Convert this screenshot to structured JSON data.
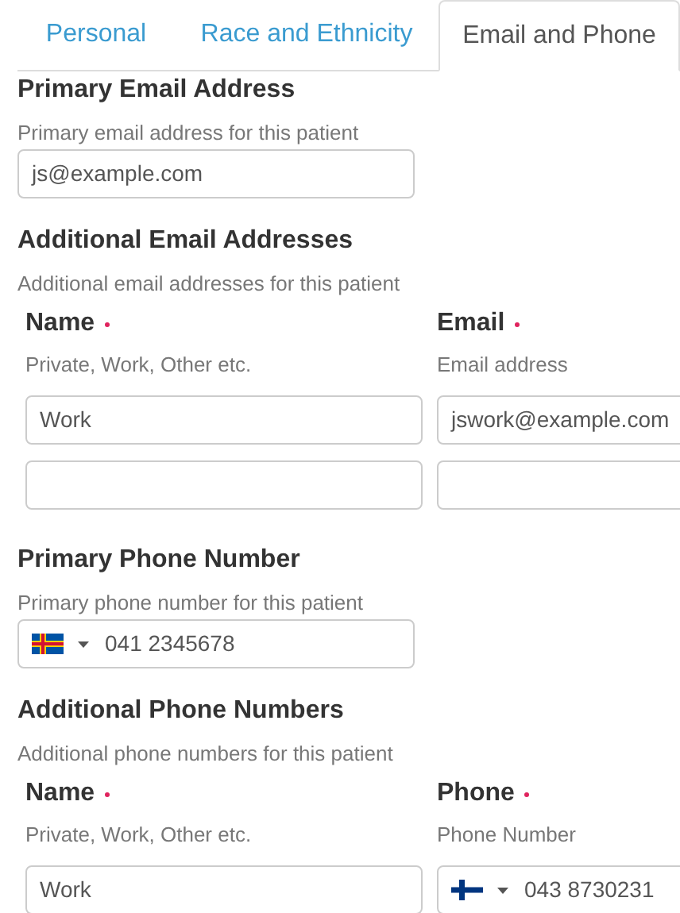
{
  "tabs": [
    {
      "label": "Personal",
      "selected": false
    },
    {
      "label": "Race and Ethnicity",
      "selected": false
    },
    {
      "label": "Email and Phone",
      "selected": true
    }
  ],
  "primary_email": {
    "title": "Primary Email Address",
    "help": "Primary email address for this patient",
    "value": "js@example.com"
  },
  "additional_emails": {
    "title": "Additional Email Addresses",
    "help": "Additional email addresses for this patient",
    "columns": [
      {
        "label": "Name",
        "required": true,
        "help": "Private, Work, Other etc."
      },
      {
        "label": "Email",
        "required": true,
        "help": "Email address"
      }
    ],
    "rows": [
      {
        "name": "Work",
        "value": "jswork@example.com"
      },
      {}
    ]
  },
  "primary_phone": {
    "title": "Primary Phone Number",
    "help": "Primary phone number for this patient",
    "value": "041 2345678"
  },
  "additional_phones": {
    "title": "Additional Phone Numbers",
    "help": "Additional phone numbers for this patient",
    "columns": [
      {
        "label": "Name",
        "required": true,
        "help": "Private, Work, Other etc."
      },
      {
        "label": "Phone",
        "required": true,
        "help": "Phone Number"
      }
    ],
    "rows": [
      {
        "name": "Work",
        "value": "043 8730231"
      }
    ]
  }
}
